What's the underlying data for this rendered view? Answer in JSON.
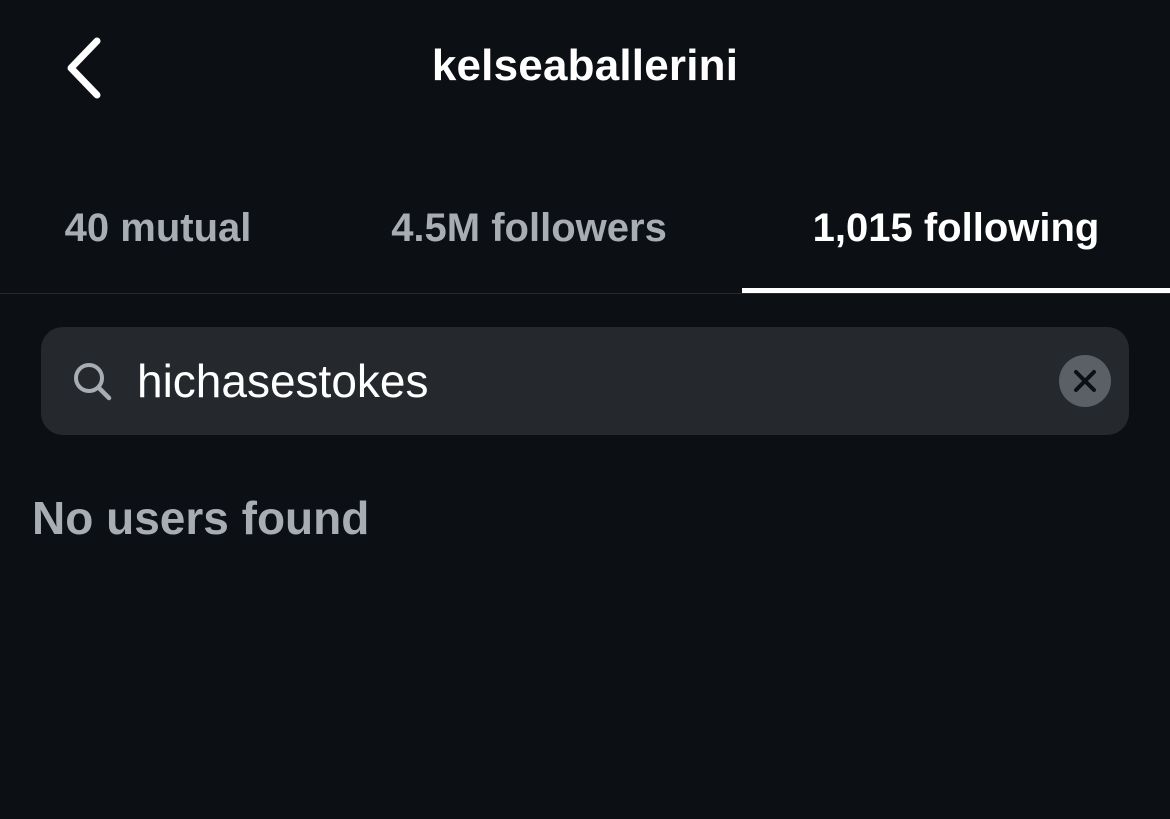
{
  "header": {
    "back_icon": "chevron-left-icon",
    "title": "kelseaballerini"
  },
  "tabs": [
    {
      "label": "40 mutual",
      "active": false
    },
    {
      "label": "4.5M followers",
      "active": false
    },
    {
      "label": "1,015 following",
      "active": true
    }
  ],
  "search": {
    "icon": "search-icon",
    "value": "hichasestokes",
    "clear_icon": "close-icon"
  },
  "results": {
    "empty_message": "No users found"
  },
  "colors": {
    "background": "#0c1014",
    "search_background": "#25292e",
    "muted_text": "#a8acb3",
    "active_text": "#ffffff",
    "clear_button": "#5b5f66"
  }
}
